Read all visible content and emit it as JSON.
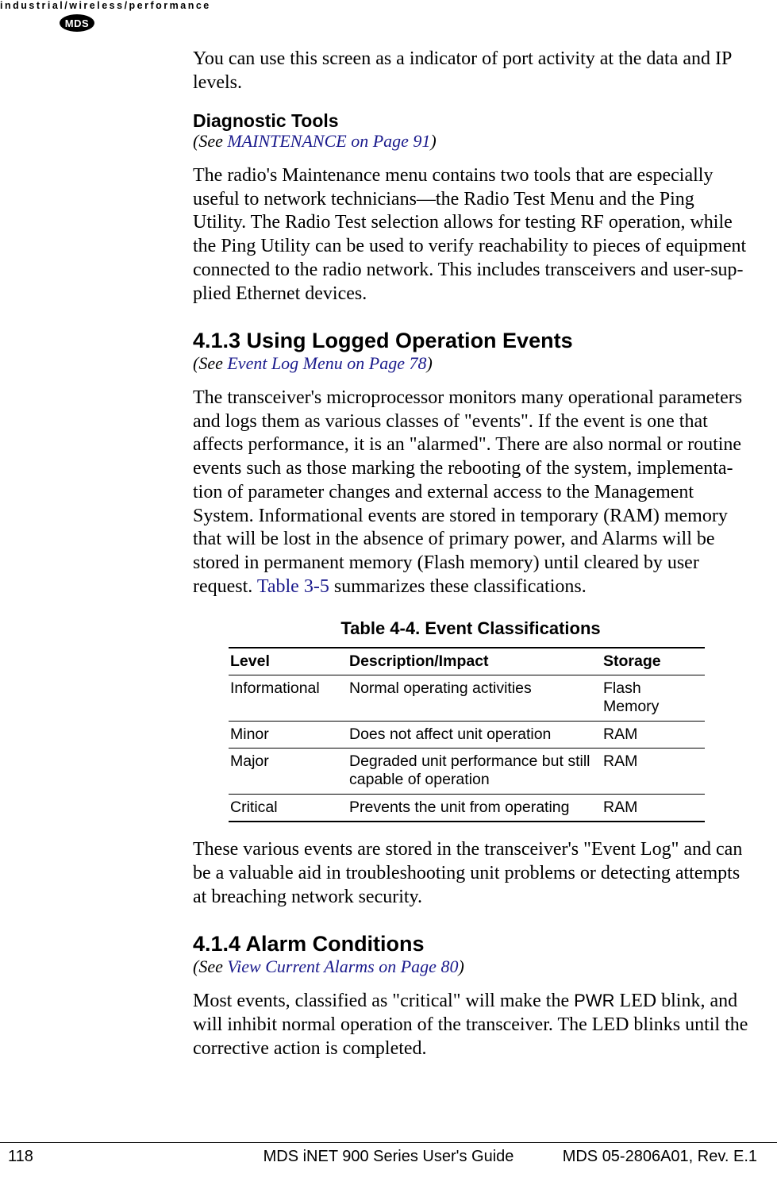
{
  "header": {
    "tagline": "industrial/wireless/performance",
    "logo_text": "MDS"
  },
  "intro_paragraph": "You can use this screen as a indicator of port activity at the data and IP levels.",
  "diag_tools": {
    "heading": "Diagnostic Tools",
    "see_prefix": "(See ",
    "see_link": "MAINTENANCE on Page 91",
    "see_suffix": ")",
    "body": "The radio's Maintenance menu contains two tools that are especially useful to network technicians—the Radio Test Menu and the Ping Utility. The Radio Test selection allows for testing RF operation, while the Ping Utility can be used to verify reachability to pieces of equipment connected to the radio network. This includes transceivers and user-sup­plied Ethernet devices."
  },
  "section_413": {
    "heading": "4.1.3 Using Logged Operation Events",
    "see_prefix": "(See ",
    "see_link": "Event Log Menu on Page 78",
    "see_suffix": ")",
    "body_part1": "The transceiver's microprocessor monitors many operational parame­ters and logs them as various classes of \"events\". If the event is one that affects performance, it is an \"alarmed\". There are also normal or routine events such as those marking the rebooting of the system, implementa­tion of parameter changes and external access to the Management System. Informational events are stored in temporary (RAM) memory that will be lost in the absence of primary power, and Alarms will be stored in permanent memory (Flash memory) until cleared by user request. ",
    "body_link": "Table 3-5",
    "body_part2": " summarizes these classifications."
  },
  "table": {
    "caption": "Table 4-4. Event Classifications",
    "headers": {
      "c1": "Level",
      "c2": "Description/Impact",
      "c3": "Storage"
    },
    "rows": [
      {
        "level": "Informational",
        "desc": "Normal operating activities",
        "storage": "Flash Memory"
      },
      {
        "level": "Minor",
        "desc": "Does not affect unit operation",
        "storage": "RAM"
      },
      {
        "level": "Major",
        "desc": "Degraded unit performance but still capable of operation",
        "storage": "RAM"
      },
      {
        "level": "Critical",
        "desc": "Prevents the unit from operating",
        "storage": "RAM"
      }
    ]
  },
  "after_table": "These various events are stored in the transceiver's \"Event Log\" and can be a valuable aid in troubleshooting unit problems or detecting attempts at breaching network security.",
  "section_414": {
    "heading": "4.1.4 Alarm Conditions",
    "see_prefix": "(See ",
    "see_link": "View Current Alarms on Page 80",
    "see_suffix": ")",
    "body_part1": "Most events, classified as \"critical\" will make the ",
    "body_pwr": "PWR",
    "body_part2": " LED blink, and will inhibit normal operation of the transceiver. The LED blinks until the corrective action is completed."
  },
  "footer": {
    "page": "118",
    "title": "MDS iNET 900 Series User's Guide",
    "doc": "MDS 05-2806A01, Rev. E.1"
  }
}
